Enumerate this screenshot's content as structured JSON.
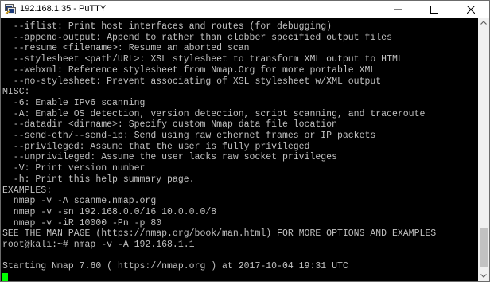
{
  "window": {
    "title": "192.168.1.35 - PuTTY",
    "icon": "putty-icon"
  },
  "controls": {
    "minimize_icon": "minimize-icon",
    "maximize_icon": "maximize-icon",
    "close_icon": "close-icon"
  },
  "terminal": {
    "colors": {
      "background": "#000000",
      "foreground": "#c0c0c0",
      "cursor": "#00ff00"
    },
    "lines": [
      "  --iflist: Print host interfaces and routes (for debugging)",
      "  --append-output: Append to rather than clobber specified output files",
      "  --resume <filename>: Resume an aborted scan",
      "  --stylesheet <path/URL>: XSL stylesheet to transform XML output to HTML",
      "  --webxml: Reference stylesheet from Nmap.Org for more portable XML",
      "  --no-stylesheet: Prevent associating of XSL stylesheet w/XML output",
      "MISC:",
      "  -6: Enable IPv6 scanning",
      "  -A: Enable OS detection, version detection, script scanning, and traceroute",
      "  --datadir <dirname>: Specify custom Nmap data file location",
      "  --send-eth/--send-ip: Send using raw ethernet frames or IP packets",
      "  --privileged: Assume that the user is fully privileged",
      "  --unprivileged: Assume the user lacks raw socket privileges",
      "  -V: Print version number",
      "  -h: Print this help summary page.",
      "EXAMPLES:",
      "  nmap -v -A scanme.nmap.org",
      "  nmap -v -sn 192.168.0.0/16 10.0.0.0/8",
      "  nmap -v -iR 10000 -Pn -p 80",
      "SEE THE MAN PAGE (https://nmap.org/book/man.html) FOR MORE OPTIONS AND EXAMPLES",
      "root@kali:~# nmap -v -A 192.168.1.1",
      "",
      "Starting Nmap 7.60 ( https://nmap.org ) at 2017-10-04 19:31 UTC"
    ]
  },
  "scrollbar": {
    "up_icon": "scroll-up-arrow-icon",
    "down_icon": "scroll-down-arrow-icon"
  }
}
